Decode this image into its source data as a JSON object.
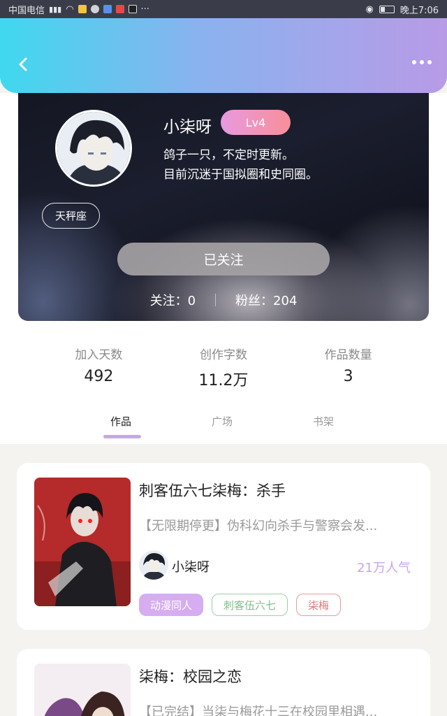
{
  "status_bar": {
    "carrier": "中国电信",
    "time": "晚上7:06"
  },
  "header": {
    "back_icon": "chevron-left-icon",
    "more_icon": "more-dots-icon"
  },
  "profile": {
    "username": "小柒呀",
    "level": "Lv4",
    "bio_line1": "鸽子一只，不定时更新。",
    "bio_line2": "目前沉迷于国拟圈和史同圈。",
    "zodiac": "天秤座",
    "follow_button": "已关注",
    "following": "关注：0",
    "followers": "粉丝：204"
  },
  "stats": [
    {
      "label": "加入天数",
      "value": "492"
    },
    {
      "label": "创作字数",
      "value": "11.2万"
    },
    {
      "label": "作品数量",
      "value": "3"
    }
  ],
  "tabs": [
    {
      "label": "作品",
      "active": true
    },
    {
      "label": "广场",
      "active": false
    },
    {
      "label": "书架",
      "active": false
    }
  ],
  "works": [
    {
      "title": "刺客伍六七柒梅：杀手",
      "description": "【无限期停更】伪科幻向杀手与警察会发...",
      "author": "小柒呀",
      "popularity": "21万人气",
      "tags": [
        "动漫同人",
        "刺客伍六七",
        "柒梅"
      ]
    },
    {
      "title": "柒梅：校园之恋",
      "description": "【已完结】当柒与梅花十三在校园里相遇..."
    }
  ],
  "colors": {
    "header_start": "#3fd8ef",
    "header_end": "#b89be7",
    "level_badge": "#f78f98",
    "popularity": "#c7a6e6",
    "tab_indicator": "#c5a8e8"
  }
}
